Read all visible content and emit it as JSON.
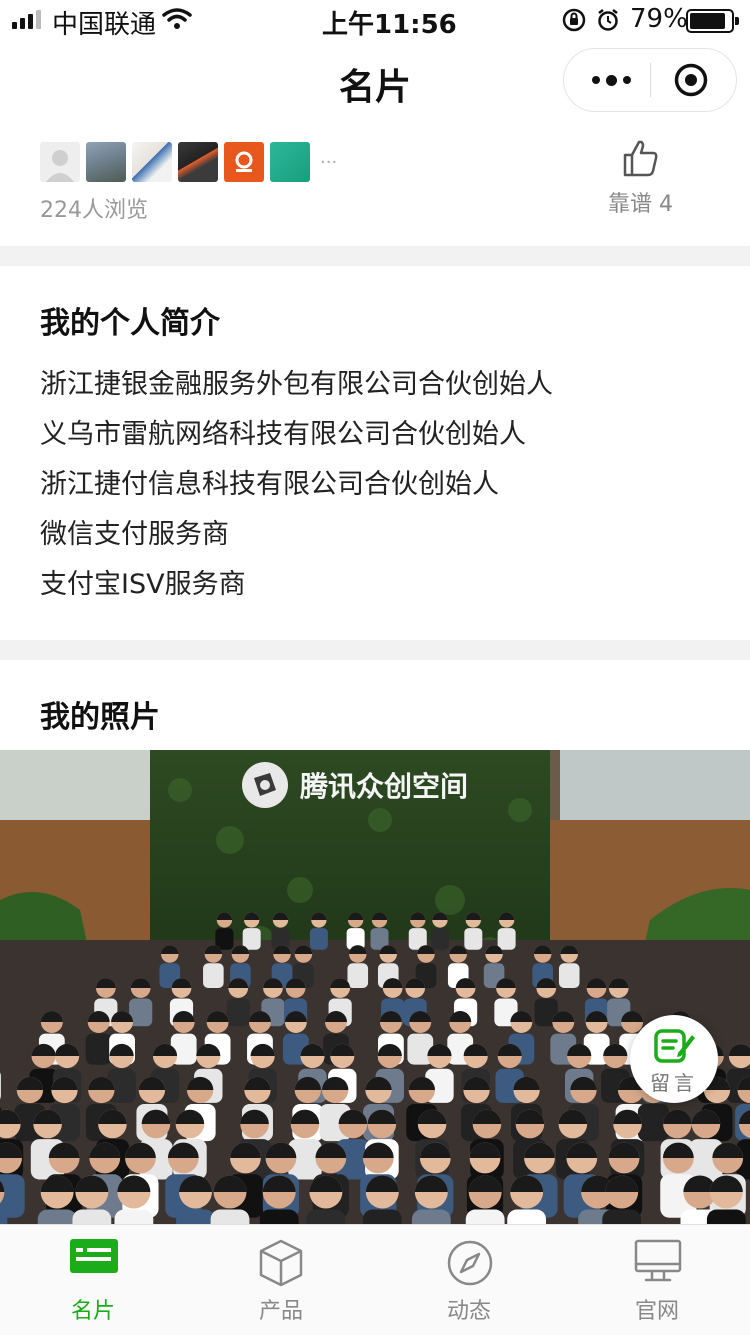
{
  "status_bar": {
    "carrier": "中国联通",
    "time": "上午11:56",
    "battery": "79%",
    "battery_level": 0.79
  },
  "nav": {
    "title": "名片"
  },
  "viewers": {
    "count_label": "224人浏览",
    "more": "···"
  },
  "like": {
    "label": "靠谱",
    "count": "4"
  },
  "intro": {
    "title": "我的个人简介",
    "lines": [
      "浙江捷银金融服务外包有限公司合伙创始人",
      "义乌市雷航网络科技有限公司合伙创始人",
      "浙江捷付信息科技有限公司合伙创始人",
      "微信支付服务商",
      "支付宝ISV服务商"
    ]
  },
  "photos": {
    "title": "我的照片",
    "sign_text": "腾讯众创空间"
  },
  "message_button": {
    "label": "留言"
  },
  "tabs": [
    {
      "label": "名片",
      "icon": "card-icon",
      "active": true
    },
    {
      "label": "产品",
      "icon": "box-icon",
      "active": false
    },
    {
      "label": "动态",
      "icon": "compass-icon",
      "active": false
    },
    {
      "label": "官网",
      "icon": "monitor-icon",
      "active": false
    }
  ],
  "colors": {
    "accent": "#1aad19",
    "gap": "#f2f2f2",
    "muted": "#999999"
  }
}
